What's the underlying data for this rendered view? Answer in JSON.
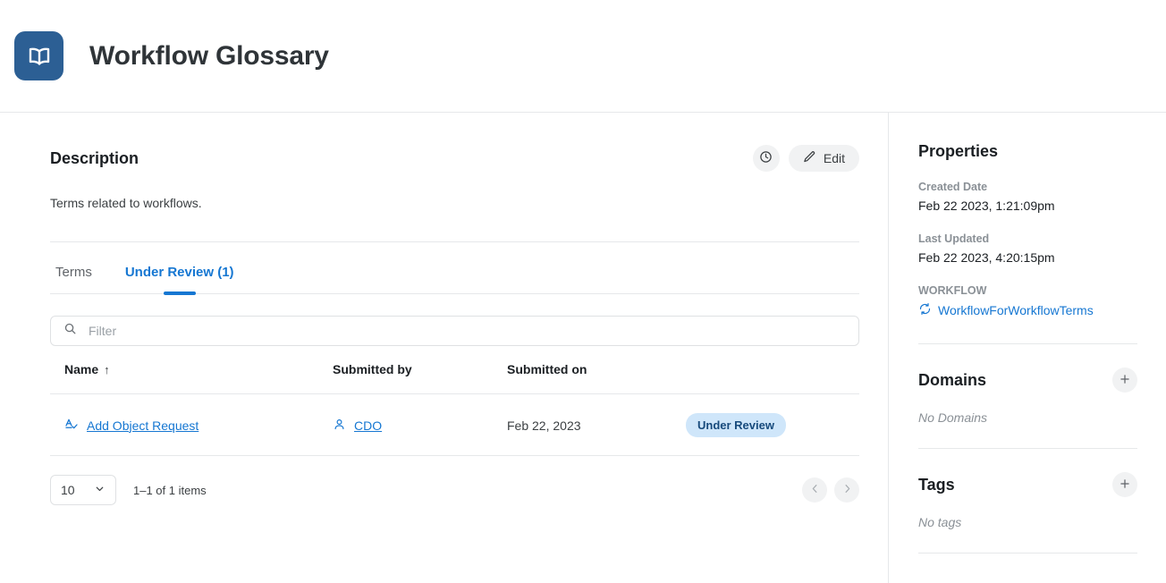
{
  "header": {
    "title": "Workflow Glossary",
    "logo_icon": "open-book-icon",
    "logo_color": "#2c5f94"
  },
  "description": {
    "title": "Description",
    "body": "Terms related to workflows.",
    "history_icon": "clock-icon",
    "edit_label": "Edit",
    "edit_icon": "pencil-icon"
  },
  "tabs": [
    {
      "label": "Terms",
      "active": false
    },
    {
      "label": "Under Review (1)",
      "active": true
    }
  ],
  "filter": {
    "placeholder": "Filter",
    "value": "",
    "icon": "search-icon"
  },
  "table": {
    "columns": [
      "Name",
      "Submitted by",
      "Submitted on",
      ""
    ],
    "sort_column": "Name",
    "sort_direction": "ascending",
    "sort_arrow": "↑",
    "rows": [
      {
        "name": "Add Object Request",
        "name_icon": "glossary-term-icon",
        "submitted_by": "CDO",
        "submitted_by_icon": "user-icon",
        "submitted_on": "Feb 22, 2023",
        "status": "Under Review",
        "status_bg": "#cfe6fa",
        "status_color": "#174a7c"
      }
    ]
  },
  "pagination": {
    "page_size": "10",
    "chevron_icon": "chevron-down-icon",
    "items_text": "1–1 of 1 items",
    "prev_icon": "chevron-left-icon",
    "next_icon": "chevron-right-icon"
  },
  "sidebar": {
    "properties": {
      "title": "Properties",
      "created_date_label": "Created Date",
      "created_date_value": "Feb 22 2023, 1:21:09pm",
      "last_updated_label": "Last Updated",
      "last_updated_value": "Feb 22 2023, 4:20:15pm",
      "workflow_label": "WORKFLOW",
      "workflow_value": "WorkflowForWorkflowTerms",
      "workflow_icon": "workflow-icon"
    },
    "domains": {
      "title": "Domains",
      "empty": "No Domains",
      "add_icon": "plus-icon"
    },
    "tags": {
      "title": "Tags",
      "empty": "No tags",
      "add_icon": "plus-icon"
    }
  },
  "colors": {
    "accent": "#1677d2",
    "brand": "#2c5f94",
    "border": "#e6e8ea",
    "muted": "#8a9096"
  }
}
